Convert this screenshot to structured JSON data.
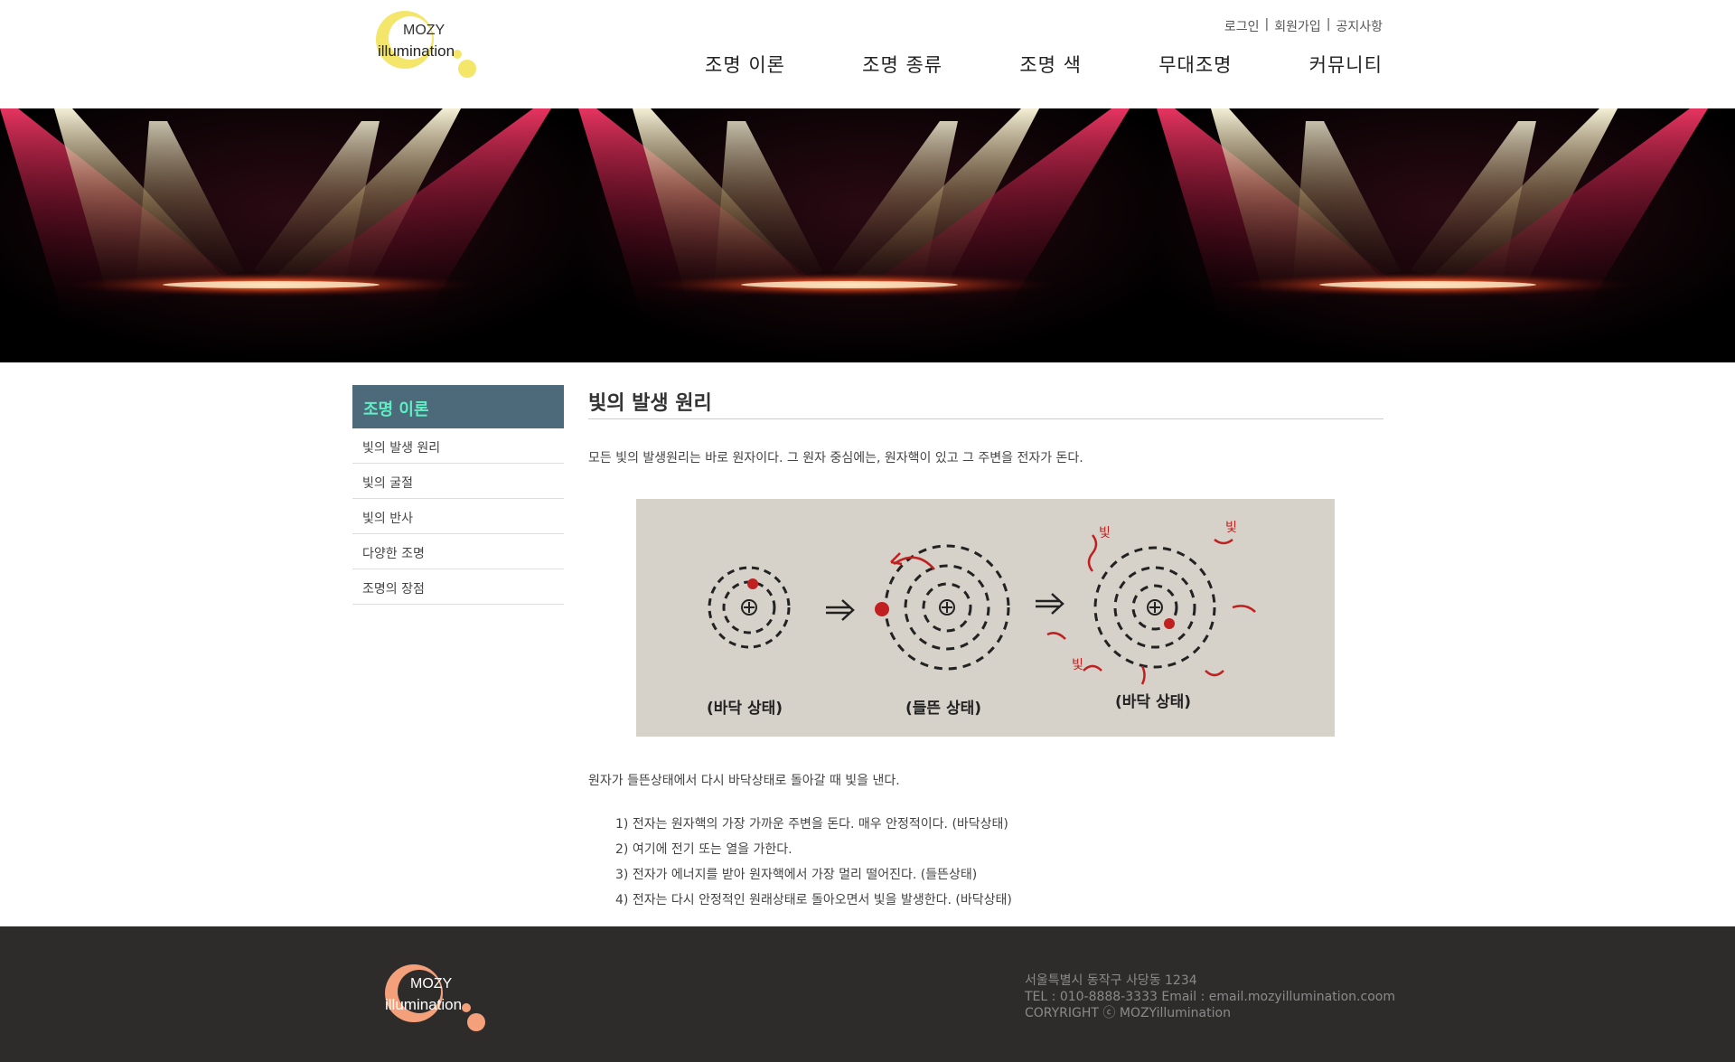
{
  "brand": {
    "logo_text_top": "MOZY",
    "logo_text_bottom": "illumination",
    "logo_color": "#f3e66a",
    "footer_logo_color": "#f4a07a"
  },
  "util_nav": {
    "login": "로그인",
    "join": "회원가입",
    "notice": "공지사항",
    "separator": "|"
  },
  "gnb": {
    "items": [
      "조명 이론",
      "조명 종류",
      "조명 색",
      "무대조명",
      "커뮤니티"
    ]
  },
  "sidebar": {
    "title": "조명 이론",
    "title_color": "#5ef0c4",
    "items": [
      "빛의 발생 원리",
      "빛의 굴절",
      "빛의 반사",
      "다양한 조명",
      "조명의 장점"
    ]
  },
  "content": {
    "title": "빛의 발생 원리",
    "intro": "모든 빛의 발생원리는 바로 원자이다. 그 원자 중심에는, 원자핵이 있고 그 주변을 전자가 돈다.",
    "figure_labels": [
      "(바닥 상태)",
      "(들뜬 상태)",
      "(바닥 상태)"
    ],
    "figure_annotation": "빛",
    "paragraph": "원자가 들뜬상태에서 다시 바닥상태로 돌아갈 때 빛을 낸다.",
    "steps": [
      "1) 전자는 원자핵의 가장 가까운 주변을 돈다. 매우 안정적이다. (바닥상태)",
      "2) 여기에 전기 또는 열을 가한다.",
      "3) 전자가 에너지를 받아 원자핵에서 가장 멀리 떨어진다. (들뜬상태)",
      "4) 전자는 다시 안정적인 원래상태로 돌아오면서 빛을 발생한다. (바닥상태)"
    ]
  },
  "footer": {
    "address": "서울특별시 동작구 사당동 1234",
    "contact": "TEL : 010-8888-3333 Email : email.mozyillumination.coom",
    "copyright": "CORYRIGHT ⓒ MOZYillumination"
  }
}
